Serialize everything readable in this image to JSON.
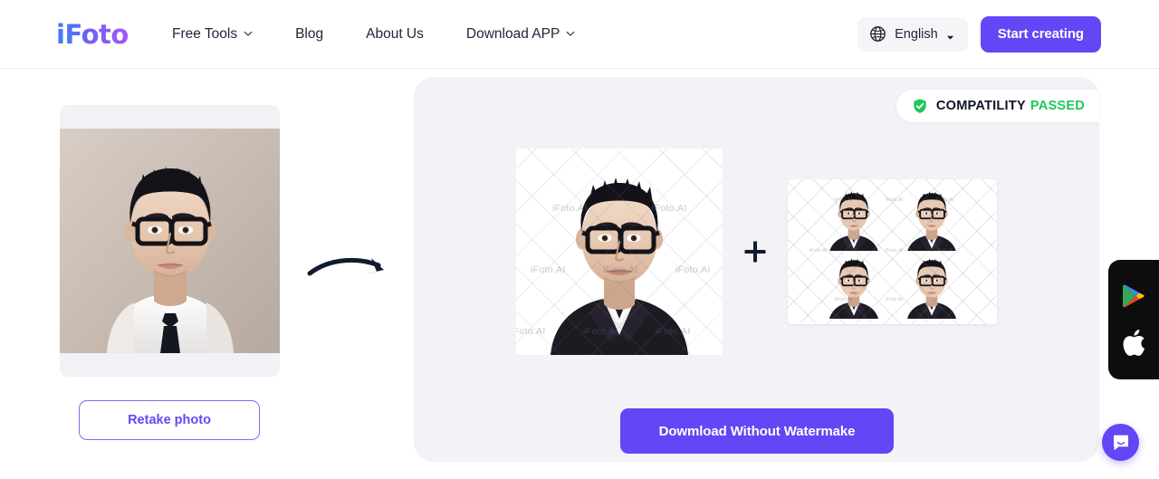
{
  "header": {
    "logo_text": "iFoto",
    "nav": [
      {
        "label": "Free Tools",
        "has_dropdown": true
      },
      {
        "label": "Blog",
        "has_dropdown": false
      },
      {
        "label": "About Us",
        "has_dropdown": false
      },
      {
        "label": "Download APP",
        "has_dropdown": true
      }
    ],
    "language": {
      "label": "English",
      "icon": "globe-icon",
      "caret": "caret-down-icon"
    },
    "start_button": "Start creating"
  },
  "left": {
    "retake_button": "Retake photo",
    "photo_alt": "original uploaded portrait"
  },
  "arrow": {
    "icon": "curved-arrow-right-icon"
  },
  "main": {
    "badge": {
      "icon": "shield-check-icon",
      "text_primary": "COMPATILITY",
      "text_status": "PASSED"
    },
    "plus": "+",
    "watermark_text": "iFoto.AI",
    "download_button": "Dowmload Without Watermake",
    "single_photo_alt": "processed passport photo with watermark",
    "sheet_alt": "4-up passport photo print sheet"
  },
  "floating": {
    "app_dock": [
      {
        "name": "google-play-icon"
      },
      {
        "name": "apple-icon"
      }
    ],
    "chat": {
      "icon": "chat-bubble-icon"
    }
  },
  "colors": {
    "accent": "#6147f5",
    "accent_light": "#7c6cf5",
    "panel_bg": "#f2f2f7",
    "success": "#23c55e",
    "text_dark": "#1f2438"
  }
}
